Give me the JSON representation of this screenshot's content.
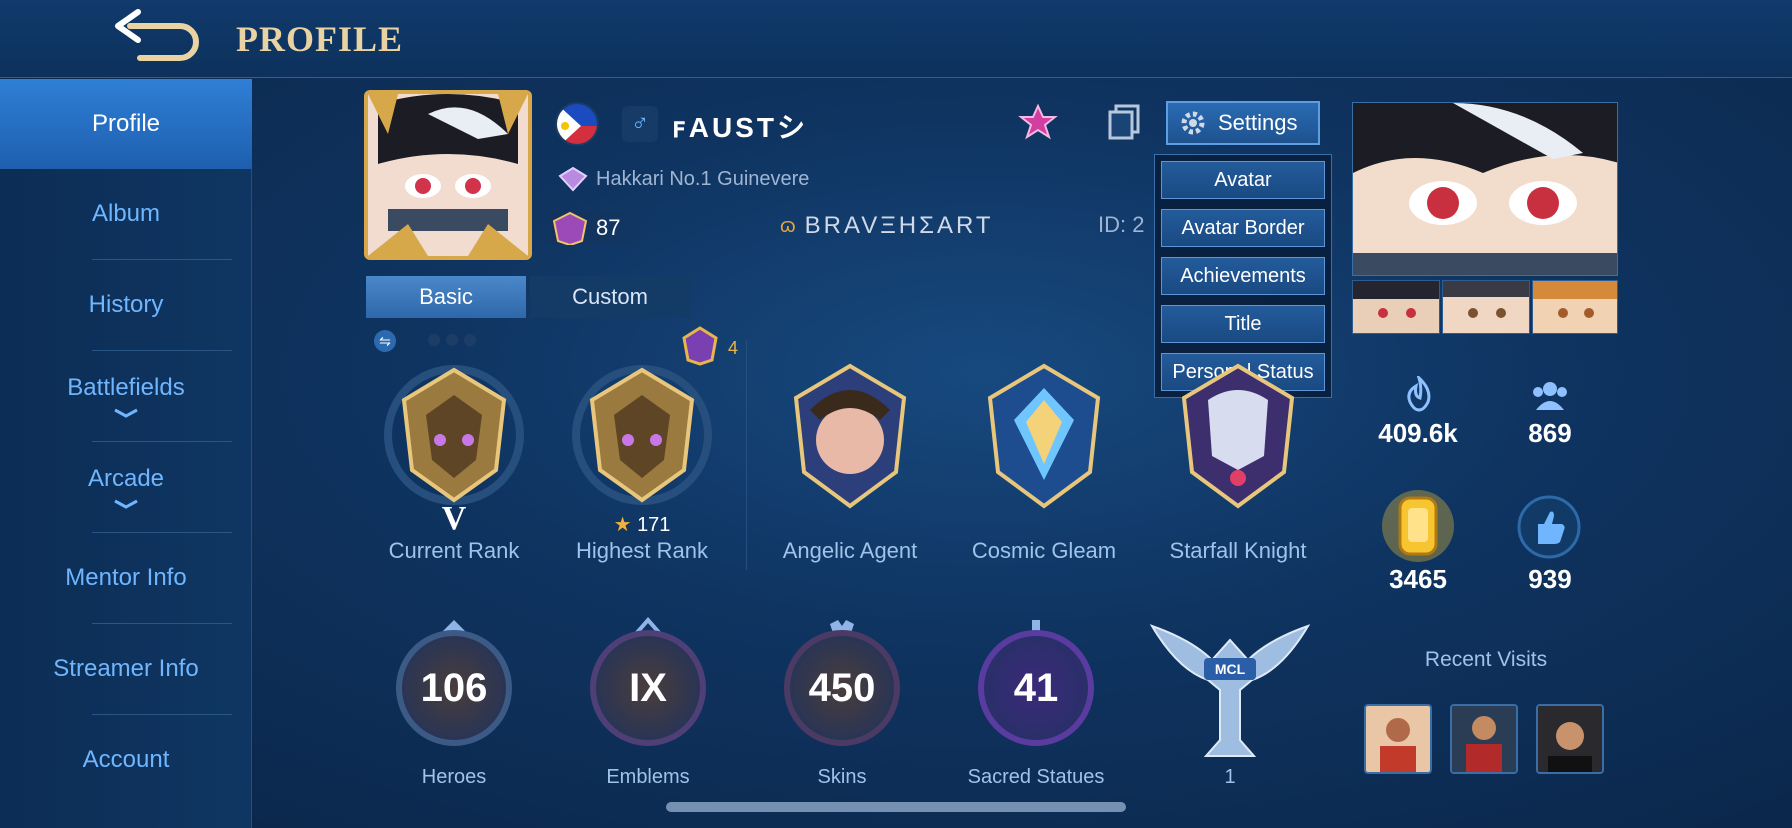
{
  "header": {
    "title": "PROFILE",
    "back_icon": "back-arrow-icon"
  },
  "sidebar": {
    "items": [
      {
        "label": "Profile",
        "active": true
      },
      {
        "label": "Album"
      },
      {
        "label": "History"
      },
      {
        "label": "Battlefields",
        "expandable": true
      },
      {
        "label": "Arcade",
        "expandable": true
      },
      {
        "label": "Mentor Info"
      },
      {
        "label": "Streamer Info"
      },
      {
        "label": "Account"
      }
    ]
  },
  "profile": {
    "name": "ꜰAUSTシ",
    "gender_symbol": "♂",
    "title_badge": "Hakkari No.1 Guinevere",
    "level": "87",
    "squad": "BRAVΞHΣART",
    "id_label": "ID:  2"
  },
  "top_buttons": {
    "settings_label": "Settings"
  },
  "dropdown": {
    "items": [
      "Avatar",
      "Avatar Border",
      "Achievements",
      "Title",
      "Personal Status"
    ]
  },
  "tabs": {
    "basic": "Basic",
    "custom": "Custom"
  },
  "ranks": {
    "current_rank_numeral": "V",
    "current_rank_label": "Current Rank",
    "highest_rank_stars": "171",
    "highest_rank_label": "Highest Rank",
    "mythic_count": "4",
    "skins": [
      "Angelic Agent",
      "Cosmic Gleam",
      "Starfall Knight"
    ]
  },
  "stats": {
    "heroes": {
      "value": "106",
      "label": "Heroes"
    },
    "emblems": {
      "value": "IX",
      "label": "Emblems"
    },
    "skins": {
      "value": "450",
      "label": "Skins"
    },
    "statues": {
      "value": "41",
      "label": "Sacred Statues"
    },
    "mcl": {
      "value": "1"
    }
  },
  "right_panel": {
    "popularity": "409.6k",
    "friends": "869",
    "charisma": "3465",
    "likes": "939",
    "recent_visits_label": "Recent Visits"
  },
  "colors": {
    "gold": "#e9d3a3",
    "accent_blue": "#6fb6ff",
    "active_tab": "#3a7bbd"
  }
}
